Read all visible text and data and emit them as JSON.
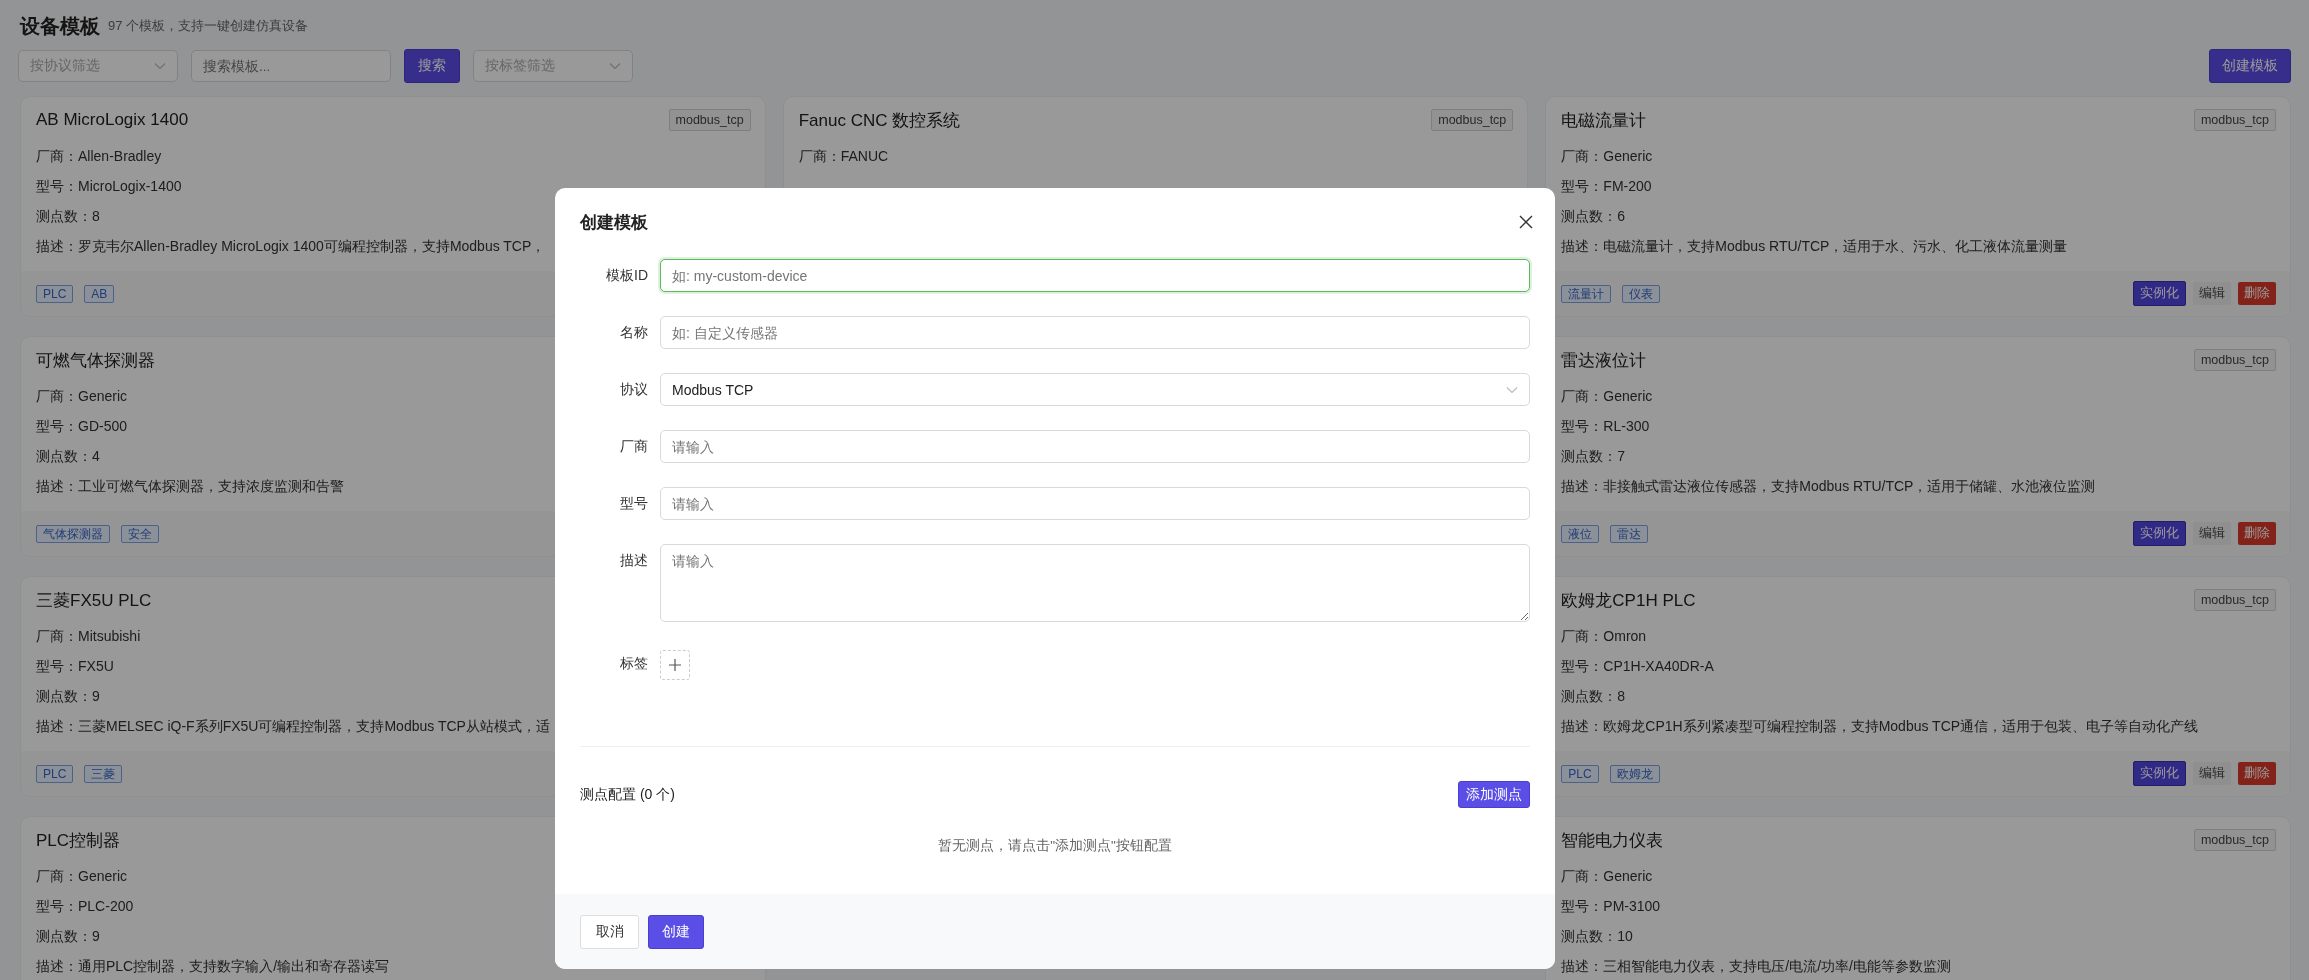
{
  "page": {
    "title": "设备模板",
    "subtitle": "97 个模板，支持一键创建仿真设备"
  },
  "filters": {
    "protocol_placeholder": "按协议筛选",
    "search_placeholder": "搜索模板...",
    "search_button": "搜索",
    "tag_placeholder": "按标签筛选"
  },
  "create_button": "创建模板",
  "columns": [
    {
      "cards": [
        {
          "name": "AB MicroLogix 1400",
          "protocol": "modbus_tcp",
          "vendor": "厂商：Allen-Bradley",
          "model": "型号：MicroLogix-1400",
          "points": "测点数：8",
          "description": "描述：罗克韦尔Allen-Bradley MicroLogix 1400可编程控制器，支持Modbus TCP，",
          "tags": [
            "PLC",
            "AB"
          ]
        },
        {
          "name": "可燃气体探测器",
          "vendor": "厂商：Generic",
          "model": "型号：GD-500",
          "points": "测点数：4",
          "description": "描述：工业可燃气体探测器，支持浓度监测和告警",
          "tags": [
            "气体探测器",
            "安全"
          ]
        },
        {
          "name": "三菱FX5U PLC",
          "vendor": "厂商：Mitsubishi",
          "model": "型号：FX5U",
          "points": "测点数：9",
          "description": "描述：三菱MELSEC iQ-F系列FX5U可编程控制器，支持Modbus TCP从站模式，适",
          "tags": [
            "PLC",
            "三菱"
          ]
        },
        {
          "name": "PLC控制器",
          "vendor": "厂商：Generic",
          "model": "型号：PLC-200",
          "points": "测点数：9",
          "description": "描述：通用PLC控制器，支持数字输入/输出和寄存器读写"
        }
      ]
    },
    {
      "cards": [
        {
          "name": "Fanuc CNC 数控系统",
          "protocol": "modbus_tcp",
          "vendor": "厂商：FANUC"
        }
      ]
    },
    {
      "cards": [
        {
          "name": "电磁流量计",
          "protocol": "modbus_tcp",
          "vendor": "厂商：Generic",
          "model": "型号：FM-200",
          "points": "测点数：6",
          "description": "描述：电磁流量计，支持Modbus RTU/TCP，适用于水、污水、化工液体流量测量",
          "tags": [
            "流量计",
            "仪表"
          ],
          "actions": [
            {
              "label": "实例化",
              "kind": "primary"
            },
            {
              "label": "编辑",
              "kind": "default"
            },
            {
              "label": "删除",
              "kind": "danger"
            }
          ]
        },
        {
          "name": "雷达液位计",
          "protocol": "modbus_tcp",
          "vendor": "厂商：Generic",
          "model": "型号：RL-300",
          "points": "测点数：7",
          "description": "描述：非接触式雷达液位传感器，支持Modbus RTU/TCP，适用于储罐、水池液位监测",
          "tags": [
            "液位",
            "雷达"
          ],
          "actions": [
            {
              "label": "实例化",
              "kind": "primary"
            },
            {
              "label": "编辑",
              "kind": "default"
            },
            {
              "label": "删除",
              "kind": "danger"
            }
          ]
        },
        {
          "name": "欧姆龙CP1H PLC",
          "protocol": "modbus_tcp",
          "vendor": "厂商：Omron",
          "model": "型号：CP1H-XA40DR-A",
          "points": "测点数：8",
          "description": "描述：欧姆龙CP1H系列紧凑型可编程控制器，支持Modbus TCP通信，适用于包装、电子等自动化产线",
          "tags": [
            "PLC",
            "欧姆龙"
          ],
          "actions": [
            {
              "label": "实例化",
              "kind": "primary"
            },
            {
              "label": "编辑",
              "kind": "default"
            },
            {
              "label": "删除",
              "kind": "danger"
            }
          ]
        },
        {
          "name": "智能电力仪表",
          "protocol": "modbus_tcp",
          "vendor": "厂商：Generic",
          "model": "型号：PM-3100",
          "points": "测点数：10",
          "description": "描述：三相智能电力仪表，支持电压/电流/功率/电能等参数监测"
        }
      ]
    }
  ],
  "dialog": {
    "title": "创建模板",
    "fields": [
      {
        "label": "模板ID",
        "kind": "input",
        "placeholder": "如: my-custom-device",
        "focused": true
      },
      {
        "label": "名称",
        "kind": "input",
        "placeholder": "如: 自定义传感器",
        "focused": false
      },
      {
        "label": "协议",
        "kind": "select",
        "value": "Modbus TCP"
      },
      {
        "label": "厂商",
        "kind": "input",
        "placeholder": "请输入",
        "focused": false
      },
      {
        "label": "型号",
        "kind": "input",
        "placeholder": "请输入",
        "focused": false
      },
      {
        "label": "描述",
        "kind": "textarea",
        "placeholder": "请输入",
        "focused": false
      },
      {
        "label": "标签",
        "kind": "tags"
      }
    ],
    "points_title": "测点配置 (0 个)",
    "add_point_button": "添加测点",
    "empty_text": "暂无测点，请点击\"添加测点\"按钮配置",
    "cancel_button": "取消",
    "create_button": "创建"
  }
}
